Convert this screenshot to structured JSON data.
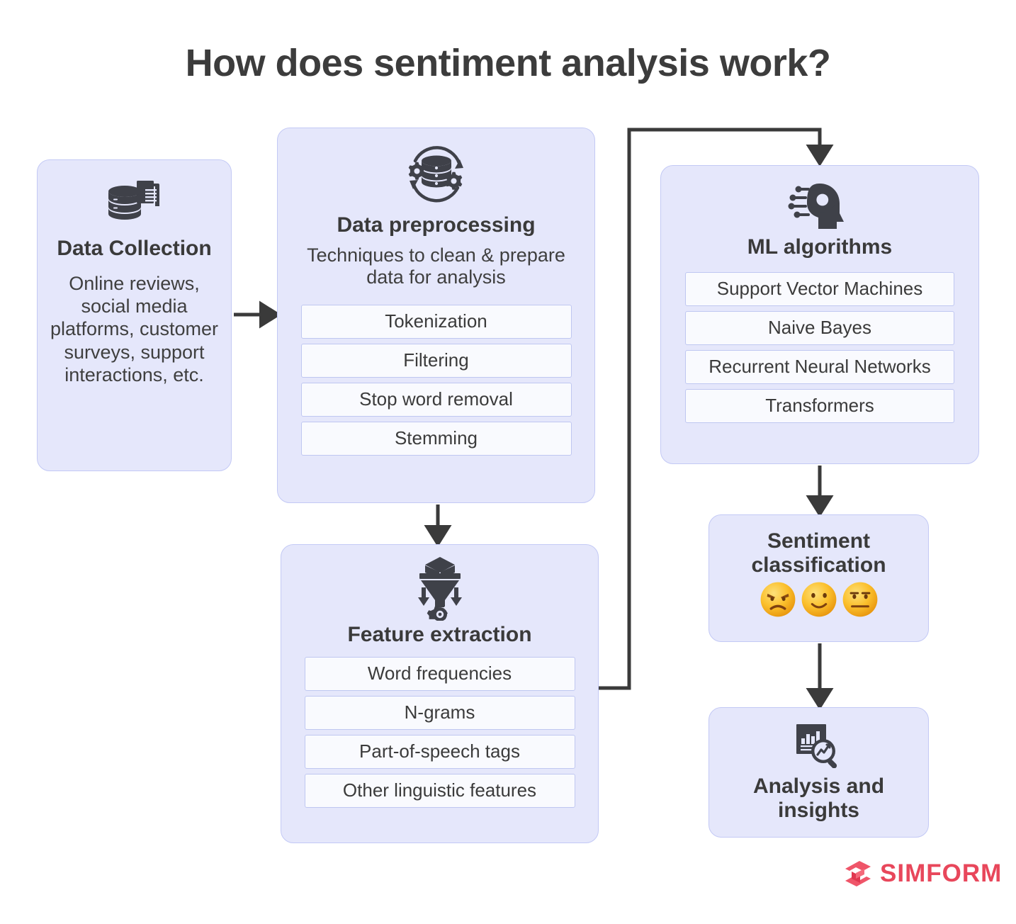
{
  "title": "How does sentiment analysis work?",
  "colors": {
    "card_bg": "#e5e7fb",
    "card_border": "#c3c9f5",
    "pill_bg": "#f9fafe",
    "pill_border": "#bfc7f1",
    "ink": "#3b3b3b",
    "icon": "#3f4149",
    "brand": "#e8475b",
    "connector": "#3a3a3a",
    "emoji_yellow": "#fcc12b"
  },
  "cards": {
    "collection": {
      "icon": "database-documents-icon",
      "title": "Data Collection",
      "body": "Online reviews, social media platforms, customer surveys, support interactions, etc."
    },
    "preprocessing": {
      "icon": "database-gears-refresh-icon",
      "title": "Data preprocessing",
      "subtitle": "Techniques to clean & prepare data for analysis",
      "items": [
        "Tokenization",
        "Filtering",
        "Stop word removal",
        "Stemming"
      ]
    },
    "feature": {
      "icon": "funnel-gear-icon",
      "title": "Feature extraction",
      "items": [
        "Word frequencies",
        "N-grams",
        "Part-of-speech tags",
        "Other linguistic features"
      ]
    },
    "ml": {
      "icon": "ai-head-gear-icon",
      "title": "ML algorithms",
      "items": [
        "Support Vector Machines",
        "Naive Bayes",
        "Recurrent Neural Networks",
        "Transformers"
      ]
    },
    "sentiment": {
      "title": "Sentiment classification",
      "emojis": [
        "angry-face-emoji",
        "slightly-smiling-face-emoji",
        "neutral-face-emoji"
      ]
    },
    "insights": {
      "icon": "chart-magnifier-icon",
      "title": "Analysis and insights"
    }
  },
  "connectors": [
    {
      "name": "collection-to-preprocessing",
      "type": "arrow-right"
    },
    {
      "name": "preprocessing-to-feature",
      "type": "arrow-down"
    },
    {
      "name": "feature-to-ml",
      "type": "elbow-up-right-down"
    },
    {
      "name": "ml-to-sentiment",
      "type": "arrow-down"
    },
    {
      "name": "sentiment-to-insights",
      "type": "arrow-down"
    }
  ],
  "logo": {
    "mark": "simform-logo-mark",
    "text": "SIMFORM"
  }
}
